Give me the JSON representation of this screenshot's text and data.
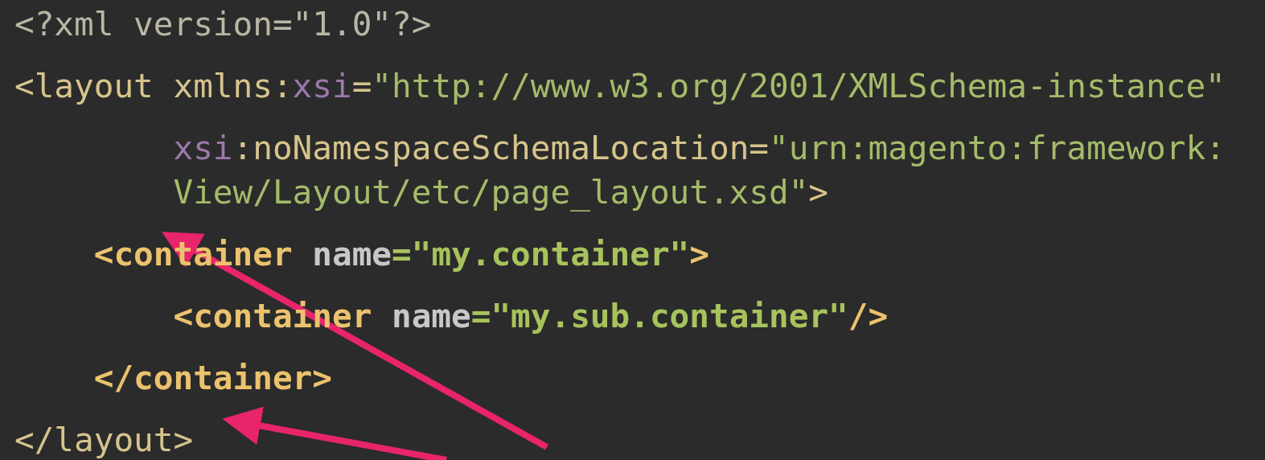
{
  "code_lines": [
    {
      "bold": false,
      "tokens": [
        {
          "kind": "punct",
          "text": "<?xml version="
        },
        {
          "kind": "punct",
          "text": "\"1.0\"?>"
        }
      ]
    },
    {
      "bold": false,
      "tokens": [
        {
          "kind": "tag",
          "text": "<layout "
        },
        {
          "kind": "tag",
          "text": "xmlns:"
        },
        {
          "kind": "ns",
          "text": "xsi"
        },
        {
          "kind": "tag",
          "text": "="
        },
        {
          "kind": "string",
          "text": "\"http://www.w3.org/2001/XMLSchema-instance\""
        }
      ],
      "continuation": [
        {
          "bold": false,
          "tokens": [
            {
              "kind": "ns",
              "text": "xsi"
            },
            {
              "kind": "tag",
              "text": ":noNamespaceSchemaLocation="
            },
            {
              "kind": "string",
              "text": "\"urn:magento:framework:"
            }
          ]
        },
        {
          "bold": false,
          "tokens": [
            {
              "kind": "string",
              "text": "View/Layout/etc/page_layout.xsd\""
            },
            {
              "kind": "tag",
              "text": ">"
            }
          ]
        }
      ],
      "children": [
        {
          "bold": true,
          "tokens": [
            {
              "kind": "tag",
              "text": "<container "
            },
            {
              "kind": "attr",
              "text": "name"
            },
            {
              "kind": "string",
              "text": "=\"my.container\""
            },
            {
              "kind": "tag",
              "text": ">"
            }
          ],
          "children": [
            {
              "bold": true,
              "tokens": [
                {
                  "kind": "tag",
                  "text": "<container "
                },
                {
                  "kind": "attr",
                  "text": "name"
                },
                {
                  "kind": "string",
                  "text": "=\"my.sub.container\""
                },
                {
                  "kind": "tag",
                  "text": "/>"
                }
              ]
            }
          ]
        },
        {
          "bold": true,
          "tokens": [
            {
              "kind": "tag",
              "text": "</container>"
            }
          ]
        }
      ]
    },
    {
      "bold": false,
      "tokens": [
        {
          "kind": "tag",
          "text": "</layout>"
        }
      ]
    }
  ]
}
